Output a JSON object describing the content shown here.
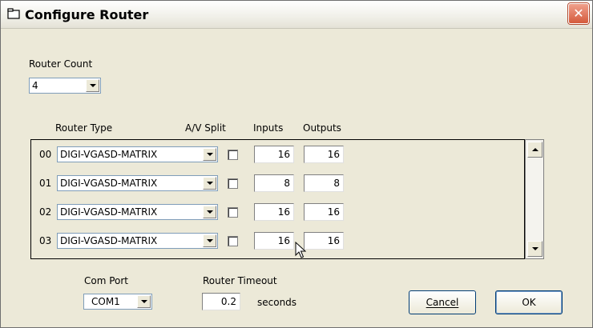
{
  "window": {
    "title": "Configure Router",
    "close_glyph": "✕"
  },
  "router_count": {
    "label": "Router Count",
    "value": "4"
  },
  "table": {
    "headers": {
      "type": "Router Type",
      "av_split": "A/V Split",
      "inputs": "Inputs",
      "outputs": "Outputs"
    },
    "rows": [
      {
        "index": "00",
        "type": "DIGI-VGASD-MATRIX",
        "av_split": false,
        "inputs": "16",
        "outputs": "16"
      },
      {
        "index": "01",
        "type": "DIGI-VGASD-MATRIX",
        "av_split": false,
        "inputs": "8",
        "outputs": "8"
      },
      {
        "index": "02",
        "type": "DIGI-VGASD-MATRIX",
        "av_split": false,
        "inputs": "16",
        "outputs": "16"
      },
      {
        "index": "03",
        "type": "DIGI-VGASD-MATRIX",
        "av_split": false,
        "inputs": "16",
        "outputs": "16"
      }
    ]
  },
  "com_port": {
    "label": "Com Port",
    "value": "COM1"
  },
  "router_timeout": {
    "label": "Router Timeout",
    "value": "0.2",
    "unit": "seconds"
  },
  "buttons": {
    "cancel": "Cancel",
    "ok": "OK"
  },
  "icons": {
    "title": "window-icon",
    "close": "close-icon",
    "cursor": "mouse-pointer-icon"
  }
}
